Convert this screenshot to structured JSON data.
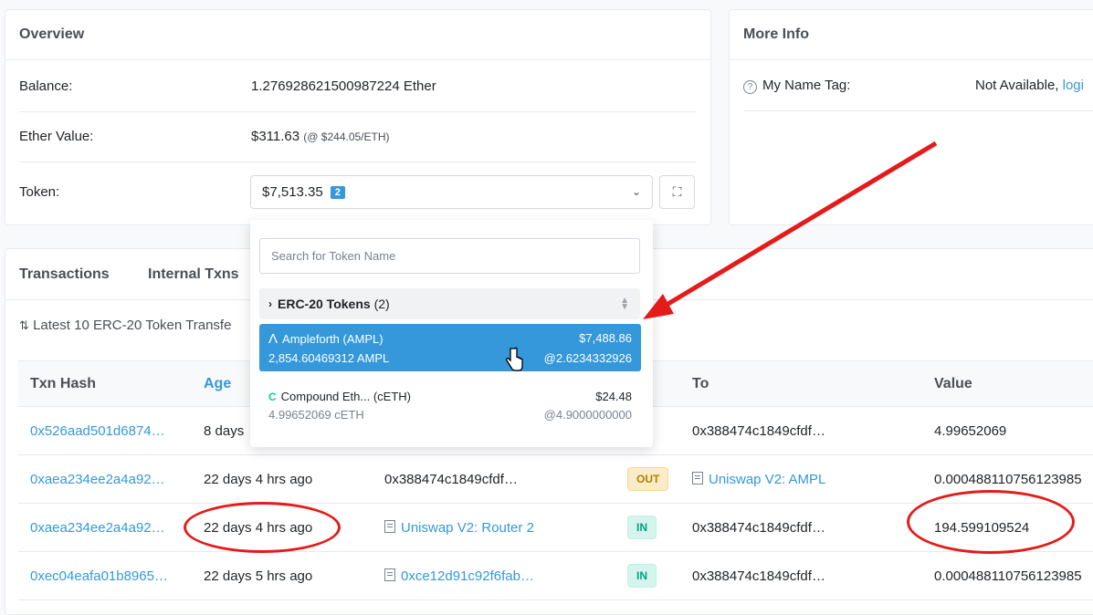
{
  "overview": {
    "title": "Overview",
    "balance_label": "Balance:",
    "balance_value": "1.276928621500987224 Ether",
    "ether_value_label": "Ether Value:",
    "ether_value": "$311.63",
    "ether_rate": "(@ $244.05/ETH)",
    "token_label": "Token:",
    "token_total": "$7,513.35",
    "token_count": "2"
  },
  "more_info": {
    "title": "More Info",
    "name_tag_label": "My Name Tag:",
    "name_tag_value": "Not Available,",
    "name_tag_link": "logi"
  },
  "tabs": [
    "Transactions",
    "Internal Txns"
  ],
  "transfers_caption": "Latest 10 ERC-20 Token Transfe",
  "dropdown": {
    "search_placeholder": "Search for Token Name",
    "group_label": "ERC-20 Tokens",
    "group_count": "(2)",
    "tokens": [
      {
        "name": "Ampleforth (AMPL)",
        "value": "$7,488.86",
        "amount": "2,854.60469312 AMPL",
        "price": "@2.6234332926",
        "icon": "Λ"
      },
      {
        "name": "Compound Eth... (cETH)",
        "value": "$24.48",
        "amount": "4.99652069 cETH",
        "price": "@4.9000000000",
        "icon": "C"
      }
    ]
  },
  "table": {
    "headers": [
      "Txn Hash",
      "Age",
      "",
      "",
      "To",
      "Value"
    ],
    "rows": [
      {
        "hash": "0x526aad501d6874…",
        "age": "8 days",
        "from": "",
        "dir": "",
        "to": "0x388474c1849cfdf…",
        "value": "4.99652069"
      },
      {
        "hash": "0xaea234ee2a4a92…",
        "age": "22 days 4 hrs ago",
        "from": "0x388474c1849cfdf…",
        "dir": "OUT",
        "to": "Uniswap V2: AMPL",
        "value": "0.000488110756123985"
      },
      {
        "hash": "0xaea234ee2a4a92…",
        "age": "22 days 4 hrs ago",
        "from": "Uniswap V2: Router 2",
        "dir": "IN",
        "to": "0x388474c1849cfdf…",
        "value": "194.599109524"
      },
      {
        "hash": "0xec04eafa01b8965…",
        "age": "22 days 5 hrs ago",
        "from": "0xce12d91c92f6fab…",
        "dir": "IN",
        "to": "0x388474c1849cfdf…",
        "value": "0.000488110756123985"
      }
    ]
  }
}
